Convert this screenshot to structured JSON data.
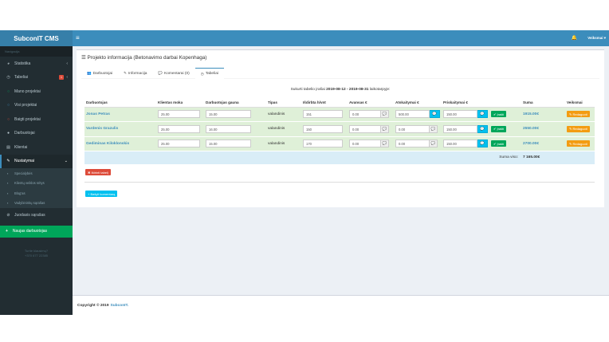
{
  "brand": "SubconIT CMS",
  "sidebar": {
    "header": "Navigacija",
    "items": [
      {
        "label": "Statistika",
        "icon": "pie-chart-icon",
        "glyph": "◕",
        "chevron": "‹"
      },
      {
        "label": "Tabeliai",
        "icon": "clock-icon",
        "glyph": "◷",
        "badge": "1",
        "chevron": "‹"
      },
      {
        "label": "Mano projektai",
        "icon": "circle-green-icon",
        "glyph": "○"
      },
      {
        "label": "Visi projektai",
        "icon": "circle-blue-icon",
        "glyph": "○"
      },
      {
        "label": "Baigti projektai",
        "icon": "circle-red-icon",
        "glyph": "○"
      },
      {
        "label": "Darbuotojai",
        "icon": "user-icon",
        "glyph": "●"
      },
      {
        "label": "Klientai",
        "icon": "id-card-icon",
        "glyph": "▤"
      },
      {
        "label": "Nustatymai",
        "icon": "wrench-icon",
        "glyph": "✎",
        "chevron": "⌄"
      }
    ],
    "subitems": [
      {
        "label": "Specialybės",
        "icon": "users-icon"
      },
      {
        "label": "Klientų veiklos sritys",
        "icon": "industry-icon"
      },
      {
        "label": "Blog'as",
        "icon": "blog-icon"
      },
      {
        "label": "Vadybininkų sąrašas",
        "icon": "manager-icon"
      }
    ],
    "extra_item": {
      "label": "Juodasis sąrašas",
      "icon": "ban-icon",
      "glyph": "⊘"
    },
    "new_project": "Naujas darbuotojas",
    "contact_label": "Turite klausimų?",
    "contact_phone": "+370 677 22385"
  },
  "topbar": {
    "menu_glyph": "≡",
    "bell_glyph": "🔔",
    "user": "Veiksmai ▾"
  },
  "box": {
    "title": "Projekto informacija (Betonavimo darbai Kopenhaga)",
    "title_glyph": "☰",
    "tabs": [
      {
        "label": "Darbuotojai",
        "glyph": "👥"
      },
      {
        "label": "Informacija",
        "glyph": "✎"
      },
      {
        "label": "Komentarai (0)",
        "glyph": "💬"
      },
      {
        "label": "Tabeliai",
        "glyph": "◷"
      }
    ],
    "period_prefix": "Sukurti tabelio įrašai",
    "period_dates": "2019-08-12 - 2019-08-31",
    "period_suffix": "laikotarpyje:"
  },
  "table": {
    "headers": [
      "Darbuotojas",
      "Klientas moka",
      "Darbuotojas gauna",
      "Tipas",
      "Išdirbta h/vnt",
      "Avansas €",
      "Atskaitymai €",
      "Priskaitymai €",
      "",
      "Suma",
      "Veiksmai"
    ],
    "rows": [
      {
        "name": "Jonas Petras",
        "client_pays": "25.00",
        "worker_gets": "15.00",
        "type": "valandinis",
        "hours": "151",
        "advance": "0.00",
        "deductions": "500.00",
        "additions": "150.00",
        "sum": "1915.00€"
      },
      {
        "name": "Vardenis Grazulis",
        "client_pays": "25.00",
        "worker_gets": "16.00",
        "type": "valandinis",
        "hours": "150",
        "advance": "0.00",
        "deductions": "0.00",
        "additions": "150.00",
        "sum": "2550.00€"
      },
      {
        "name": "Gediminas Kiloklonskis",
        "client_pays": "25.00",
        "worker_gets": "15.00",
        "type": "valandinis",
        "hours": "170",
        "advance": "0.00",
        "deductions": "0.00",
        "additions": "150.00",
        "sum": "2700.00€"
      }
    ],
    "save_label": "Įrašti",
    "edit_label": "Redaguoti",
    "comment_glyph": "💬",
    "total_label": "Suma viso:",
    "total_value": "7 165.00€"
  },
  "buttons": {
    "delete_timesheet": "Ištrinti tabelį",
    "add_comment": "+ Bašyti komentarą"
  },
  "footer": {
    "copyright": "Copyright © 2019",
    "brand": "SubconIT."
  }
}
